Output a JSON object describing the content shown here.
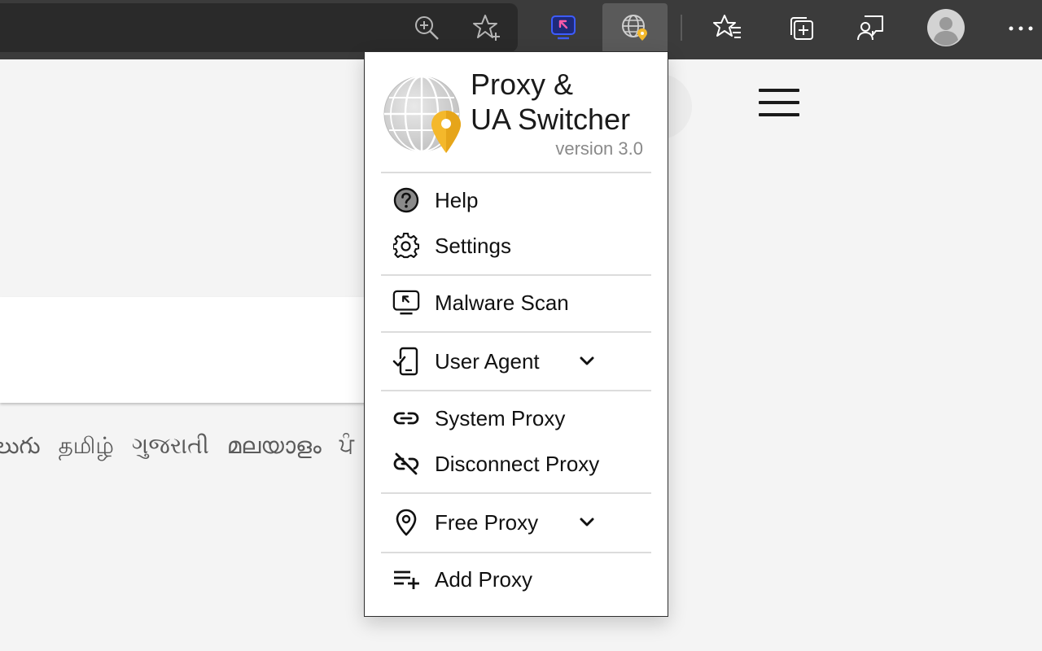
{
  "browser": {
    "toolbar_icons": [
      "zoom-icon",
      "add-favorite-icon",
      "malware-scan-extension-icon",
      "proxy-extension-icon",
      "favorites-icon",
      "collections-icon",
      "feedback-icon",
      "profile-avatar",
      "more-options-icon"
    ]
  },
  "page": {
    "languages": [
      "లుగు",
      "தமிழ்",
      "ગુજરાતી",
      "മലയാളം",
      "ਪੰ"
    ]
  },
  "popup": {
    "title_line1": "Proxy &",
    "title_line2": "UA Switcher",
    "version": "version 3.0",
    "menu": {
      "help": "Help",
      "settings": "Settings",
      "malware_scan": "Malware Scan",
      "user_agent": "User Agent",
      "system_proxy": "System Proxy",
      "disconnect_proxy": "Disconnect Proxy",
      "free_proxy": "Free Proxy",
      "add_proxy": "Add Proxy"
    },
    "colors": {
      "pin": "#f4b82b",
      "globe": "#b7b7b7"
    }
  }
}
